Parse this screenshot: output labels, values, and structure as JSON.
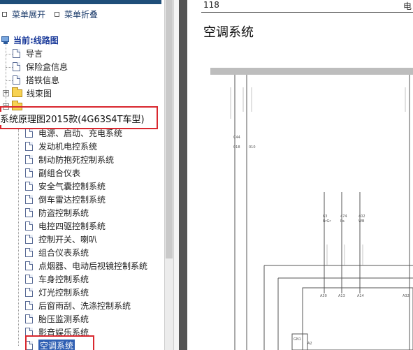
{
  "toolbar": {
    "expand_label": "菜单展开",
    "collapse_label": "菜单折叠"
  },
  "tree": {
    "root_label": "当前:线路图",
    "top_items": [
      {
        "label": "导言"
      },
      {
        "label": "保险盒信息"
      },
      {
        "label": "搭铁信息"
      },
      {
        "label": "线束图"
      }
    ],
    "system_folder_label": "系统原理图2015款(4G63S4T车型)",
    "system_items": [
      {
        "label": "电源、启动、充电系统"
      },
      {
        "label": "发动机电控系统"
      },
      {
        "label": "制动防抱死控制系统"
      },
      {
        "label": "副组合仪表"
      },
      {
        "label": "安全气囊控制系统"
      },
      {
        "label": "倒车雷达控制系统"
      },
      {
        "label": "防盗控制系统"
      },
      {
        "label": "电控四驱控制系统"
      },
      {
        "label": "控制开关、喇叭"
      },
      {
        "label": "组合仪表系统"
      },
      {
        "label": "点烟器、电动后视镜控制系统"
      },
      {
        "label": "车身控制系统"
      },
      {
        "label": "灯光控制系统"
      },
      {
        "label": "后窗雨刮、洗涤控制系统"
      },
      {
        "label": "胎压监测系统"
      },
      {
        "label": "影音娱乐系统"
      },
      {
        "label": "空调系统"
      }
    ]
  },
  "document": {
    "page_number": "118",
    "header_right": "电",
    "title": "空调系统",
    "pins": [
      "A30",
      "A13",
      "A14",
      "A32"
    ],
    "wire_labels": [
      "63",
      "474",
      "402"
    ],
    "wire_colors": [
      "BrGr",
      "Pa",
      "WB"
    ],
    "connector_labels": [
      "C44",
      "GN1",
      "A2"
    ],
    "connector_values": [
      "018",
      "010"
    ]
  },
  "colors": {
    "highlight_red": "#d9282f",
    "selection_blue": "#2f5fb3",
    "folder_yellow": "#f7d253",
    "link_blue": "#1a3a6a"
  }
}
